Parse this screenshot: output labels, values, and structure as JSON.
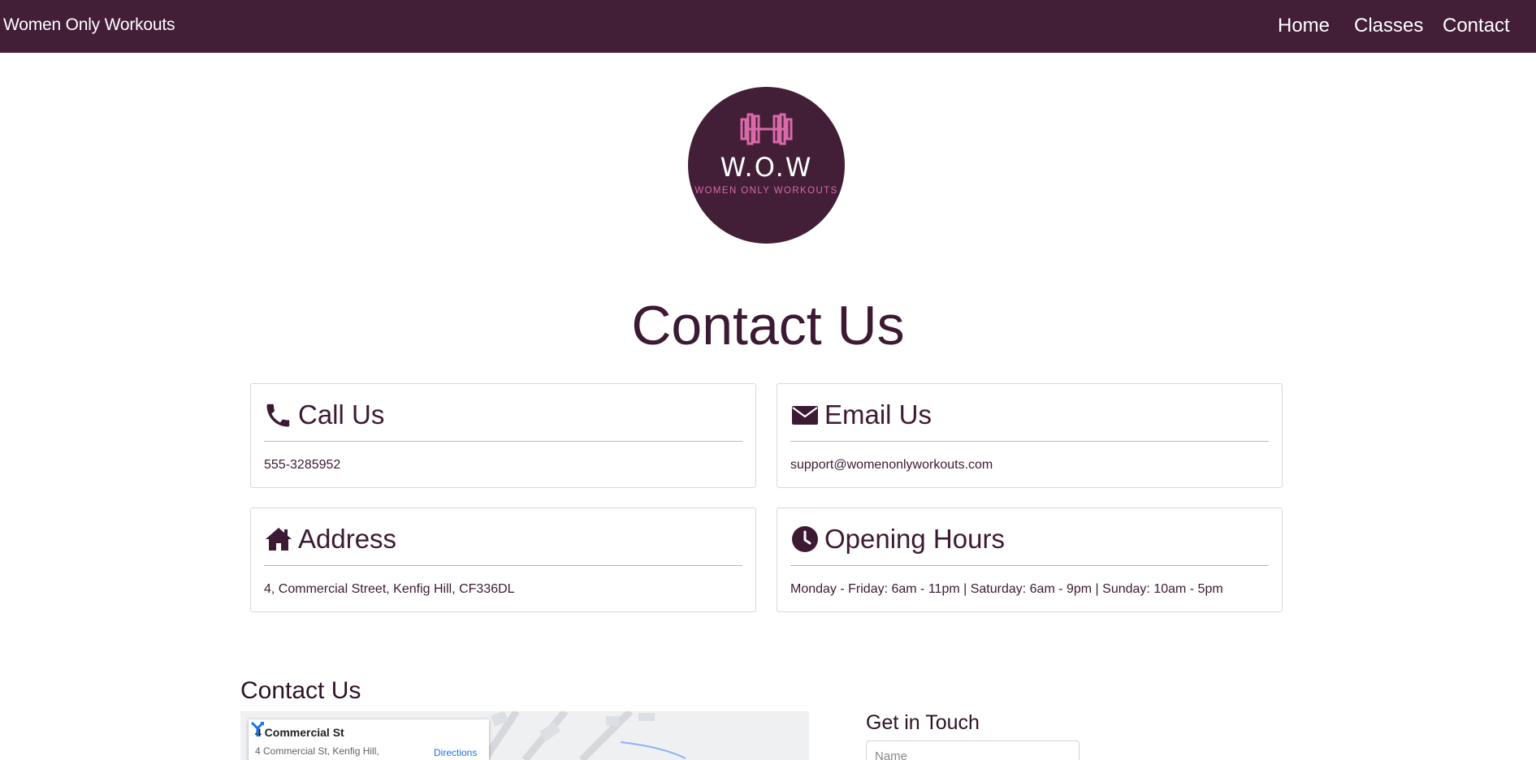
{
  "navbar": {
    "brand": "Women Only Workouts",
    "links": [
      {
        "label": "Home"
      },
      {
        "label": "Classes"
      },
      {
        "label": "Contact"
      }
    ]
  },
  "logo": {
    "title": "W.O.W",
    "subtitle": "WOMEN ONLY WORKOUTS",
    "icon": "dumbbell-icon"
  },
  "page_title": "Contact Us",
  "cards": [
    {
      "title": "Call Us",
      "icon": "phone-icon",
      "text": "555-3285952"
    },
    {
      "title": "Email Us",
      "icon": "envelope-icon",
      "text": "support@womenonlyworkouts.com"
    },
    {
      "title": "Address",
      "icon": "home-icon",
      "text": "4, Commercial Street, Kenfig Hill, CF336DL"
    },
    {
      "title": "Opening Hours",
      "icon": "clock-icon",
      "text": "Monday - Friday: 6am - 11pm | Saturday: 6am - 9pm | Sunday: 10am - 5pm"
    }
  ],
  "contact_section": {
    "title": "Contact Us",
    "map": {
      "place_name": "4 Commercial St",
      "address": "4 Commercial St, Kenfig Hill,",
      "directions_label": "Directions"
    },
    "form": {
      "title": "Get in Touch",
      "name_placeholder": "Name"
    }
  },
  "colors": {
    "nav_bg": "#421e37",
    "accent_pink": "#d86aa8",
    "text_dark": "#3d1a33"
  }
}
